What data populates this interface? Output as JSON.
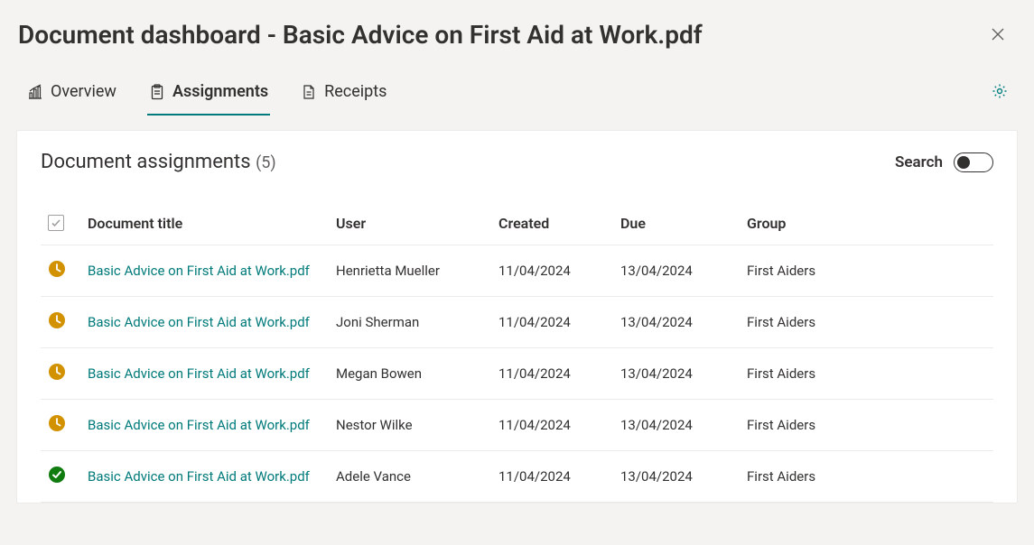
{
  "header": {
    "title": "Document dashboard - Basic Advice on First Aid at Work.pdf"
  },
  "tabs": {
    "overview": "Overview",
    "assignments": "Assignments",
    "receipts": "Receipts"
  },
  "panel": {
    "title": "Document assignments",
    "count": "(5)",
    "search_label": "Search"
  },
  "columns": {
    "title": "Document title",
    "user": "User",
    "created": "Created",
    "due": "Due",
    "group": "Group"
  },
  "rows": [
    {
      "status": "pending",
      "title": "Basic Advice on First Aid at Work.pdf",
      "user": "Henrietta Mueller",
      "created": "11/04/2024",
      "due": "13/04/2024",
      "group": "First Aiders"
    },
    {
      "status": "pending",
      "title": "Basic Advice on First Aid at Work.pdf",
      "user": "Joni Sherman",
      "created": "11/04/2024",
      "due": "13/04/2024",
      "group": "First Aiders"
    },
    {
      "status": "pending",
      "title": "Basic Advice on First Aid at Work.pdf",
      "user": "Megan Bowen",
      "created": "11/04/2024",
      "due": "13/04/2024",
      "group": "First Aiders"
    },
    {
      "status": "pending",
      "title": "Basic Advice on First Aid at Work.pdf",
      "user": "Nestor Wilke",
      "created": "11/04/2024",
      "due": "13/04/2024",
      "group": "First Aiders"
    },
    {
      "status": "complete",
      "title": "Basic Advice on First Aid at Work.pdf",
      "user": "Adele Vance",
      "created": "11/04/2024",
      "due": "13/04/2024",
      "group": "First Aiders"
    }
  ],
  "icons": {
    "status_pending_color": "#d29200",
    "status_complete_color": "#107c10"
  }
}
